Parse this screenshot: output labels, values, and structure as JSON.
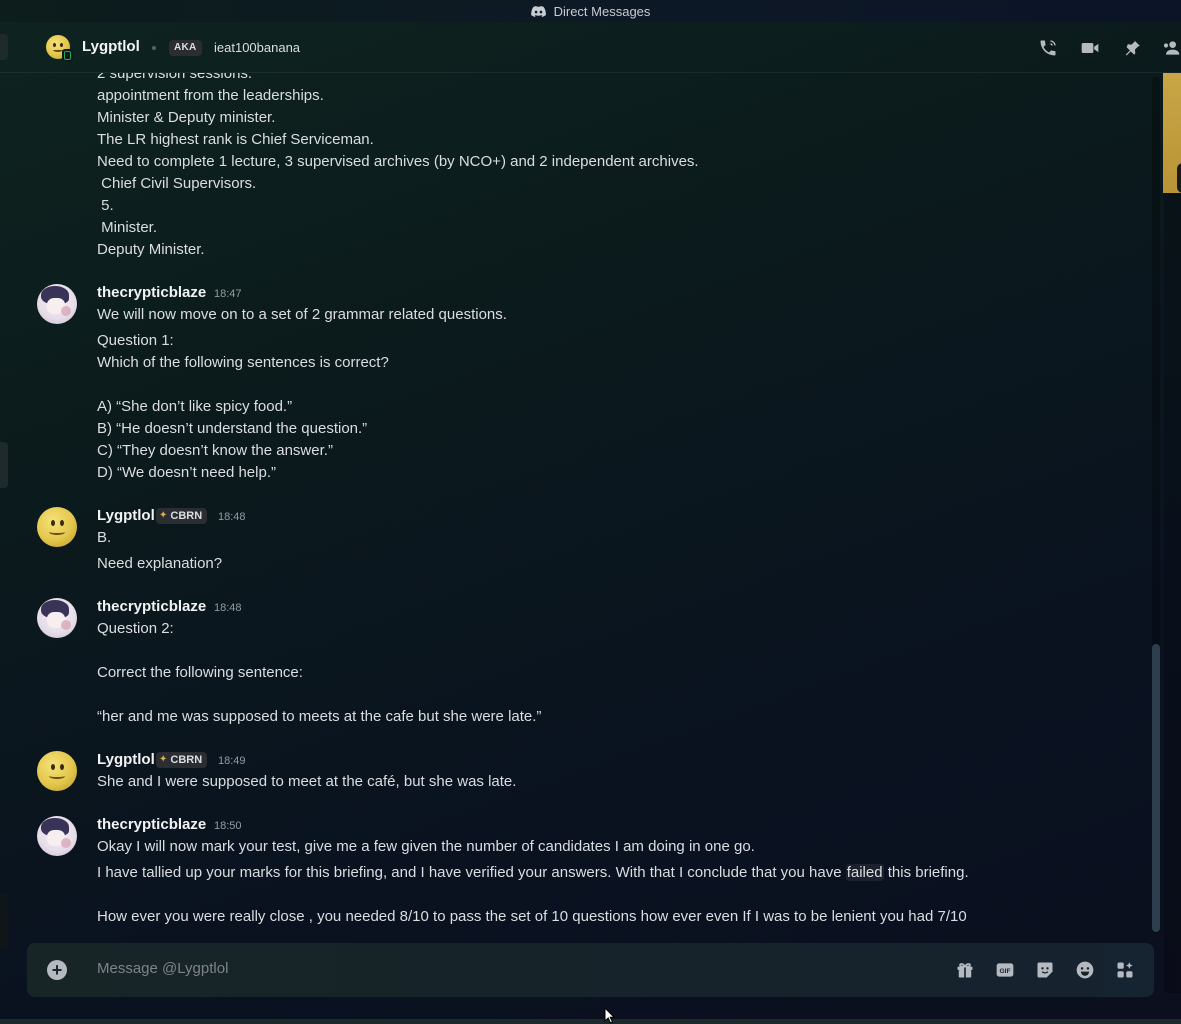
{
  "window": {
    "title": "Direct Messages"
  },
  "header": {
    "name": "Lygptlol",
    "aka_label": "AKA",
    "alias": "ieat100banana",
    "icons": [
      "phone-call-icon",
      "video-call-icon",
      "pin-icon",
      "add-friends-icon"
    ]
  },
  "messages": {
    "continued_lines": [
      "2 supervision sessions.",
      "appointment from the leaderships.",
      "Minister & Deputy minister.",
      "The LR highest rank is Chief Serviceman.",
      "Need to complete 1 lecture, 3 supervised archives (by NCO+) and 2 independent archives.",
      " Chief Civil Supervisors.",
      " 5.",
      " Minister.",
      "Deputy Minister."
    ],
    "m1": {
      "author": "thecrypticblaze",
      "time": "18:47",
      "lines": [
        "We will now move on to a set of 2 grammar related questions.",
        "Question 1:",
        "Which of the following sentences is correct?",
        "A) “She don’t like spicy food.”",
        "B) “He doesn’t understand the question.”",
        "C) “They doesn’t know the answer.”",
        "D) “We doesn’t need help.”"
      ]
    },
    "m2": {
      "author": "Lygptlol",
      "role": "CBRN",
      "time": "18:48",
      "lines": [
        "B.",
        "Need explanation?"
      ]
    },
    "m3": {
      "author": "thecrypticblaze",
      "time": "18:48",
      "lines": [
        "Question 2:",
        "Correct the following sentence:",
        "“her and me was supposed to meets at the cafe but she were late.”"
      ]
    },
    "m4": {
      "author": "Lygptlol",
      "role": "CBRN",
      "time": "18:49",
      "lines": [
        "She and I were supposed to meet at the café, but she was late."
      ]
    },
    "m5": {
      "author": "thecrypticblaze",
      "time": "18:50",
      "line1": "Okay I will now mark your test, give me a few given the number of candidates I am doing in one go.",
      "line2_pre": "I have tallied up your marks for this briefing, and I have verified your answers. With that I conclude that you have ",
      "line2_hl": "failed",
      "line2_post": " this briefing.",
      "line3": "How ever you were really close , you needed 8/10 to pass the set of 10 questions how ever even If I was to be lenient you had 7/10"
    }
  },
  "composer": {
    "placeholder": "Message @Lygptlol",
    "icons": [
      "gift-icon",
      "gif-icon",
      "sticker-icon",
      "emoji-icon",
      "apps-icon"
    ]
  },
  "colors": {
    "accent_yellow": "#e0b33a",
    "status_online": "#23a55a"
  }
}
